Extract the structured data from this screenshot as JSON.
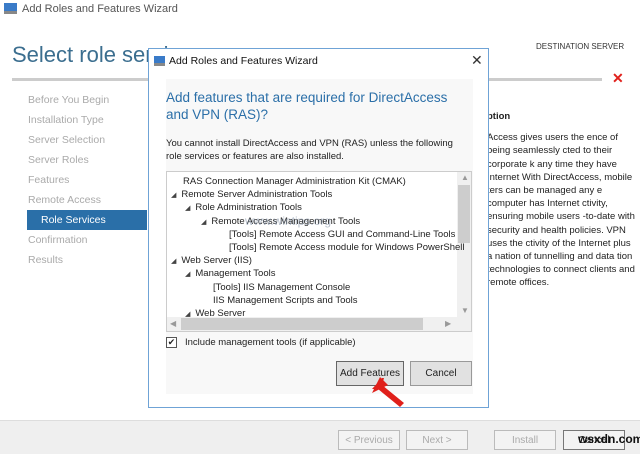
{
  "window": {
    "title": "Add Roles and Features Wizard",
    "page_title": "Select role servic",
    "destination": "DESTINATION SERVER"
  },
  "nav": [
    "Before You Begin",
    "Installation Type",
    "Server Selection",
    "Server Roles",
    "Features",
    "Remote Access",
    "Role Services",
    "Confirmation",
    "Results"
  ],
  "description": {
    "heading": "ption",
    "text": "Access gives users the ence of being seamlessly cted to their corporate k any time they have Internet With DirectAccess, mobile ters can be managed any e computer has Internet ctivity, ensuring mobile users -to-date with security and health policies. VPN uses the ctivity of the Internet plus a nation of tunnelling and data tion technologies to connect clients and remote offices."
  },
  "footer": {
    "previous": "< Previous",
    "next": "Next >",
    "install": "Install",
    "cancel": "Cancel"
  },
  "dialog": {
    "title": "Add Roles and Features Wizard",
    "heading": "Add features that are required for DirectAccess and VPN (RAS)?",
    "message": "You cannot install DirectAccess and VPN (RAS) unless the following role services or features are also installed.",
    "tree": [
      {
        "label": "RAS Connection Manager Administration Kit (CMAK)",
        "level": 0,
        "expand": false
      },
      {
        "label": "Remote Server Administration Tools",
        "level": 0,
        "expand": true
      },
      {
        "label": "Role Administration Tools",
        "level": 1,
        "expand": true
      },
      {
        "label": "Remote Access Management Tools",
        "level": 2,
        "expand": true
      },
      {
        "label": "[Tools] Remote Access GUI and Command-Line Tools",
        "level": 3,
        "expand": false
      },
      {
        "label": "[Tools] Remote Access module for Windows PowerShell",
        "level": 3,
        "expand": false
      },
      {
        "label": "Web Server (IIS)",
        "level": 0,
        "expand": true
      },
      {
        "label": "Management Tools",
        "level": 1,
        "expand": true
      },
      {
        "label": "[Tools] IIS Management Console",
        "level": 2,
        "expand": false
      },
      {
        "label": "IIS Management Scripts and Tools",
        "level": 2,
        "expand": false
      },
      {
        "label": "Web Server",
        "level": 1,
        "expand": true
      }
    ],
    "include_tools_label": "Include management tools (if applicable)",
    "include_tools_checked": true,
    "add_features": "Add Features",
    "cancel": "Cancel"
  },
  "watermarks": {
    "tree": "www.wintips.org",
    "corner": "wsxdn.com"
  }
}
